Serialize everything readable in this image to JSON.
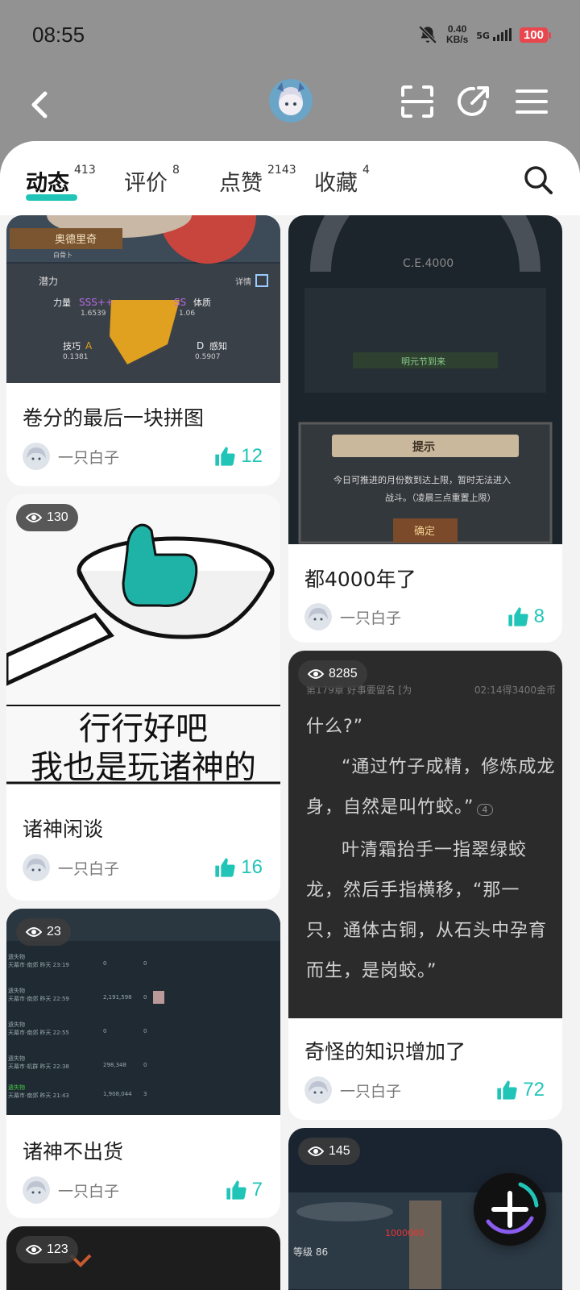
{
  "status": {
    "time": "08:55",
    "speed_value": "0.40",
    "speed_unit": "KB/s",
    "network": "5G",
    "battery": "100"
  },
  "tabs": [
    {
      "label": "动态",
      "count": "413"
    },
    {
      "label": "评价",
      "count": "8"
    },
    {
      "label": "点赞",
      "count": "2143"
    },
    {
      "label": "收藏",
      "count": "4"
    }
  ],
  "author": "一只白子",
  "cards": [
    {
      "title": "卷分的最后一块拼图",
      "likes": "12",
      "img_texts": {
        "name": "奥德里奇",
        "sub": "白骨卜",
        "potential": "潜力",
        "detail": "详情",
        "stat1": "力量",
        "v1": "SSS++",
        "n1": "1.6539",
        "stat2": "体质",
        "v2": "SS",
        "n2": "1.06",
        "stat3": "技巧",
        "v3": "A",
        "n3": "0.5907",
        "stat4": "感知",
        "v4": "D",
        "n4": "0.1381"
      }
    },
    {
      "title": "都4000年了",
      "likes": "8",
      "img_texts": {
        "era": "C.E.4000",
        "festival": "明元节到来",
        "dialog_title": "提示",
        "dialog_body": "今日可推进的月份数到达上限，暂时无法进入战斗。（凌晨三点重置上限）",
        "confirm": "确定"
      }
    },
    {
      "title": "诸神闲谈",
      "likes": "16",
      "views": "130",
      "img_texts": {
        "line1": "行行好吧",
        "line2": "我也是玩诸神的"
      }
    },
    {
      "title": "奇怪的知识增加了",
      "likes": "72",
      "views": "8285",
      "img_texts": {
        "chapter": "第179章 好事要留名 [为",
        "reward": "02:14得3400金币",
        "p1": "什么?”",
        "p2": "“通过竹子成精，修炼成龙身，自然是叫竹蛟。”",
        "p3": "叶清霜抬手一指翠绿蛟龙，然后手指横移，“那一只，通体古铜，从石头中孕育而生，是岗蛟。”",
        "comment_count": "4"
      }
    },
    {
      "title": "诸神不出货",
      "likes": "7",
      "views": "23",
      "img_texts": {
        "rows": [
          {
            "name": "遗失物",
            "time": "天幕市·南郊 昨天 23:19",
            "a": "0",
            "b": "0"
          },
          {
            "name": "遗失物",
            "time": "天幕市·南郊 昨天 22:59",
            "a": "2,191,598",
            "b": "0"
          },
          {
            "name": "遗失物",
            "time": "天幕市·南郊 昨天 22:55",
            "a": "0",
            "b": "0"
          },
          {
            "name": "遗失物",
            "time": "天幕市·机群 昨天 22:38",
            "a": "298,348",
            "b": "0"
          },
          {
            "name": "遗失物",
            "time": "天幕市·南郊 昨天 21:43",
            "a": "1,908,044",
            "b": "3"
          }
        ]
      }
    },
    {
      "title": "",
      "likes": "",
      "views": "145",
      "img_texts": {
        "level": "等级 86",
        "damage": "1000000"
      }
    },
    {
      "title": "",
      "likes": "",
      "views": "123"
    }
  ],
  "colors": {
    "accent": "#20c5b8",
    "page_bg": "#f4f4f4",
    "header_bg": "#929292"
  },
  "icons": [
    "back-icon",
    "scan-icon",
    "share-icon",
    "menu-icon",
    "search-icon",
    "thumb-up-icon",
    "eye-icon",
    "plus-icon"
  ]
}
